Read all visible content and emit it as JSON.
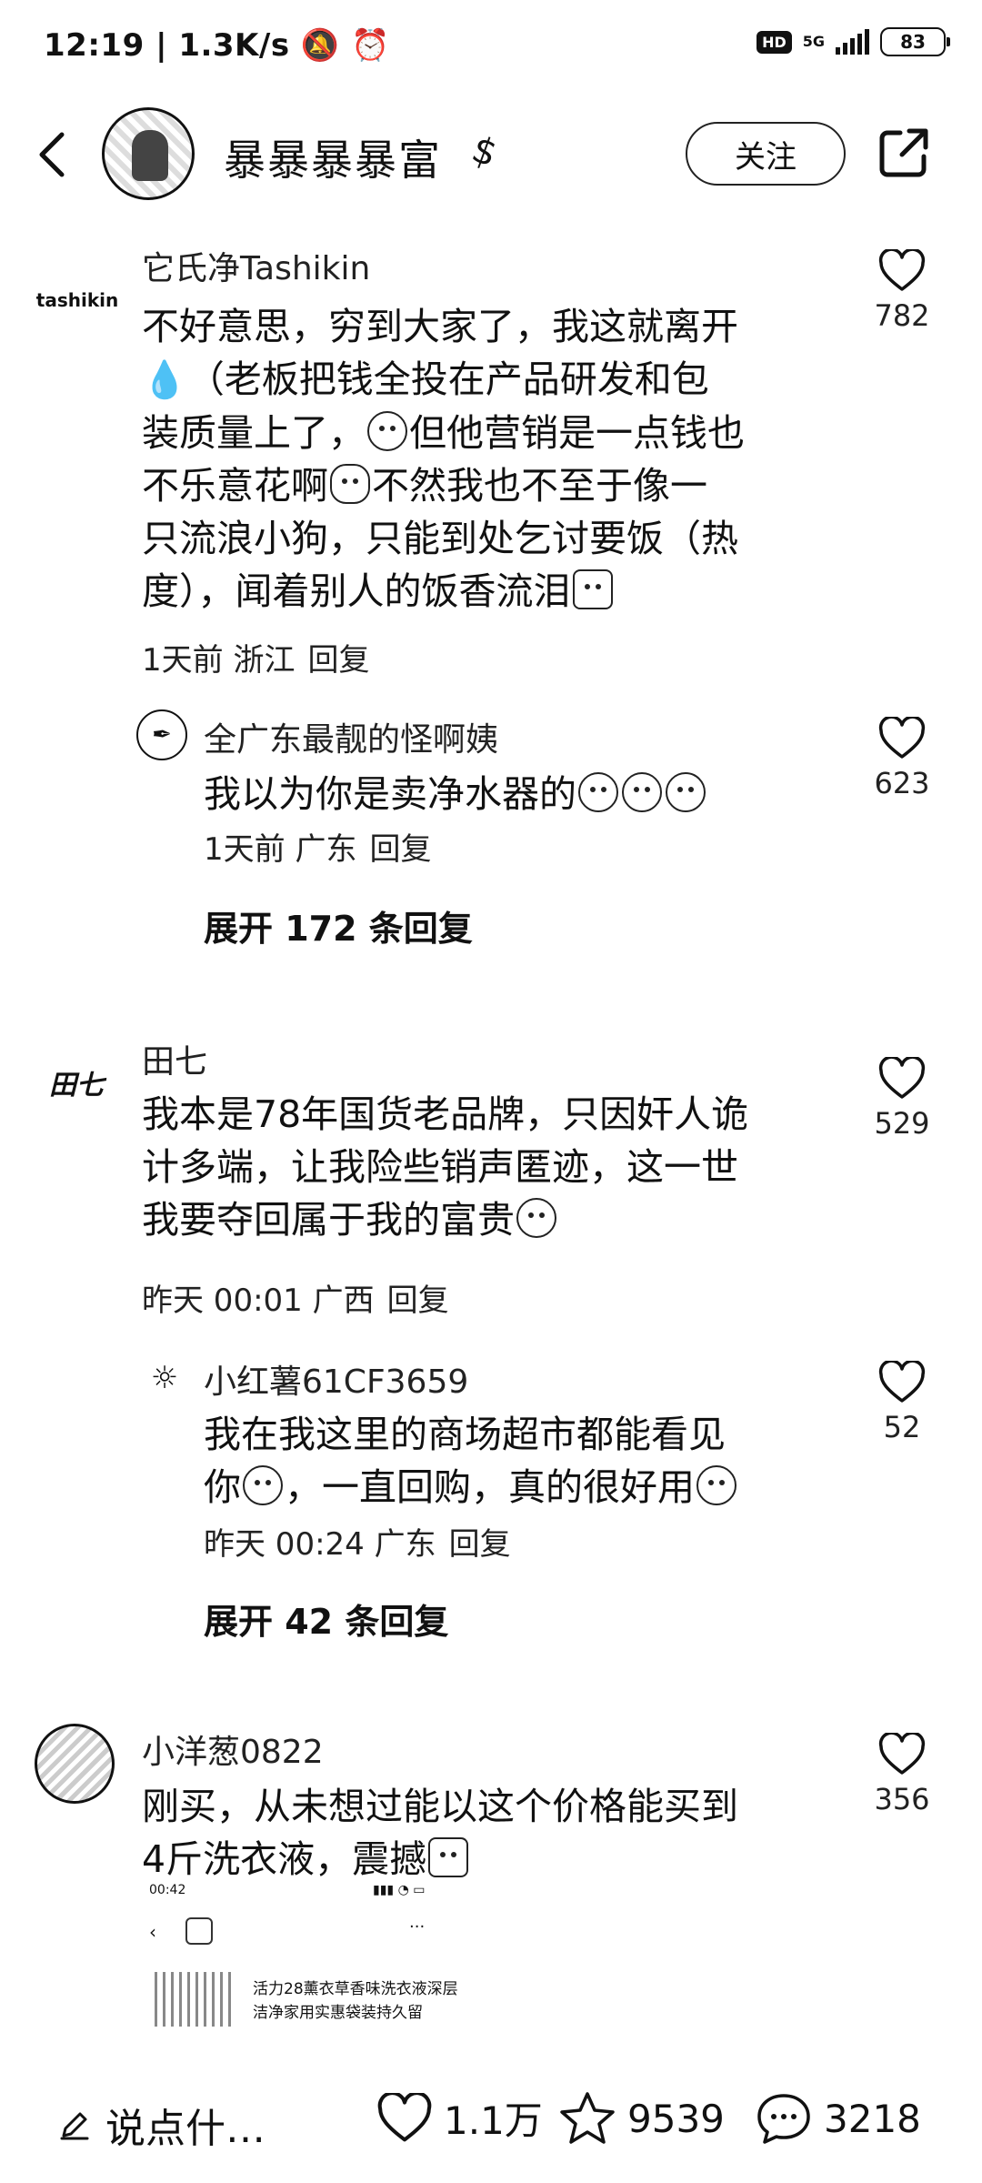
{
  "status_bar": {
    "time": "12:19",
    "speed": "1.3K/s",
    "network": "5G",
    "hd": "HD",
    "battery": "83"
  },
  "header": {
    "title": "暴暴暴暴富",
    "follow_label": "关注"
  },
  "comments": [
    {
      "avatar_text": "tashikin",
      "name": "它氏净Tashikin",
      "text_lines": [
        "不好意思，穷到大家了，我这就离开",
        "（老板把钱全投在产品研发和包",
        "装质量上了，",
        "但他营销是一点钱也",
        "不乐意花啊",
        "不然我也不至于像一",
        "只流浪小狗，只能到处乞讨要饭（热",
        "度），闻着别人的饭香流泪"
      ],
      "time": "1天前",
      "location": "浙江",
      "reply_label": "回复",
      "likes": "782"
    },
    {
      "name": "全广东最靓的怪啊姨",
      "text": "我以为你是卖净水器的",
      "time": "1天前",
      "location": "广东",
      "reply_label": "回复",
      "likes": "623",
      "expand_label": "展开 172 条回复"
    },
    {
      "avatar_text": "田七",
      "name": "田七",
      "text_lines": [
        "我本是78年国货老品牌，只因奸人诡",
        "计多端，让我险些销声匿迹，这一世",
        "我要夺回属于我的富贵"
      ],
      "time": "昨天 00:01",
      "location": "广西",
      "reply_label": "回复",
      "likes": "529"
    },
    {
      "name": "小红薯61CF3659",
      "text_lines": [
        "我在我这里的商场超市都能看见",
        "你",
        "，一直回购，真的很好用"
      ],
      "time": "昨天 00:24",
      "location": "广东",
      "reply_label": "回复",
      "likes": "52",
      "expand_label": "展开 42 条回复"
    },
    {
      "name": "小洋葱0822",
      "text_lines": [
        "刚买，从未想过能以这个价格能买到",
        "4斤洗衣液，震撼"
      ],
      "likes": "356"
    }
  ],
  "embedded_screenshot": {
    "time": "00:42",
    "title": "活力28薰衣草香味洗衣液深层洁净家用实惠袋装持久留"
  },
  "bottom_bar": {
    "input_placeholder": "说点什…",
    "likes": "1.1万",
    "favorites": "9539",
    "comments": "3218"
  }
}
